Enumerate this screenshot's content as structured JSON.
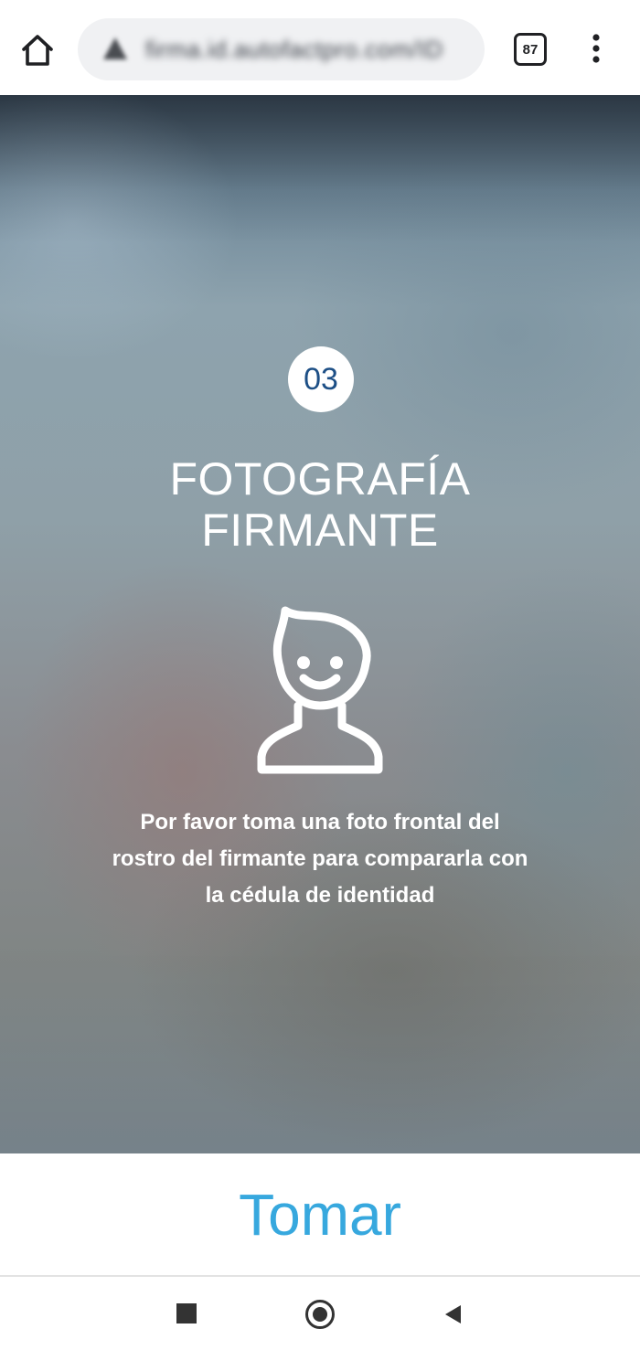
{
  "browser": {
    "url": "firma.id.autofactpro.com/ID",
    "tab_count": "87",
    "icons": {
      "home": "home-icon",
      "security": "warning-triangle-icon",
      "menu": "more-vert-icon"
    }
  },
  "step": {
    "number": "03",
    "title_line1": "FOTOGRAFÍA",
    "title_line2": "FIRMANTE",
    "icon": "face-avatar-icon",
    "instructions": "Por favor toma una foto frontal del rostro del firmante para compararla con la cédula de identidad"
  },
  "action": {
    "button_label": "Tomar"
  },
  "navbar": {
    "icons": [
      "recents-square-icon",
      "home-circle-icon",
      "back-triangle-icon"
    ]
  },
  "colors": {
    "accent": "#37a8de",
    "badge_text": "#1d4f86",
    "overlay_text": "#ffffff"
  }
}
